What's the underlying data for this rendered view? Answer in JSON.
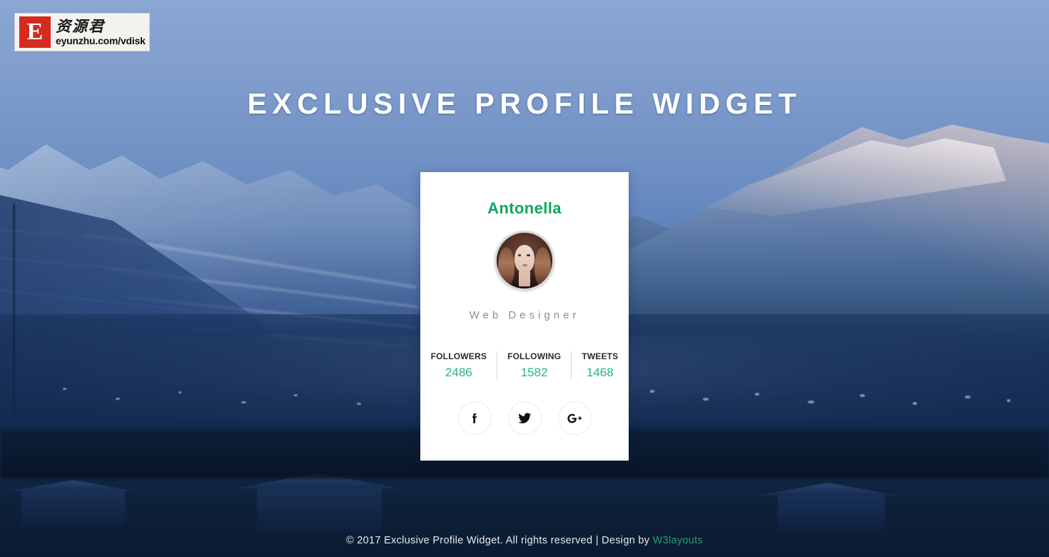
{
  "watermark": {
    "badge_letter": "E",
    "chinese_text": "资源君",
    "url_text": "eyunzhu.com/vdisk"
  },
  "header": {
    "title": "EXCLUSIVE PROFILE WIDGET"
  },
  "profile_card": {
    "name": "Antonella",
    "role": "Web Designer",
    "avatar_alt": "profile-photo",
    "stats": [
      {
        "label": "FOLLOWERS",
        "value": "2486"
      },
      {
        "label": "FOLLOWING",
        "value": "1582"
      },
      {
        "label": "TWEETS",
        "value": "1468"
      }
    ],
    "socials": [
      {
        "name": "facebook",
        "icon": "facebook-icon"
      },
      {
        "name": "twitter",
        "icon": "twitter-icon"
      },
      {
        "name": "google-plus",
        "icon": "google-plus-icon"
      }
    ]
  },
  "footer": {
    "text": "© 2017 Exclusive Profile Widget. All rights reserved | Design by ",
    "link_label": "W3layouts"
  },
  "colors": {
    "accent_green": "#0fa85c",
    "stat_green": "#23b67f",
    "link_green": "#20a06c",
    "card_background": "#ffffff",
    "title_text": "#ffffff",
    "role_text": "#8d8d8d",
    "sky_blue": "#7d9bcb",
    "valley_navy": "#13294c"
  }
}
